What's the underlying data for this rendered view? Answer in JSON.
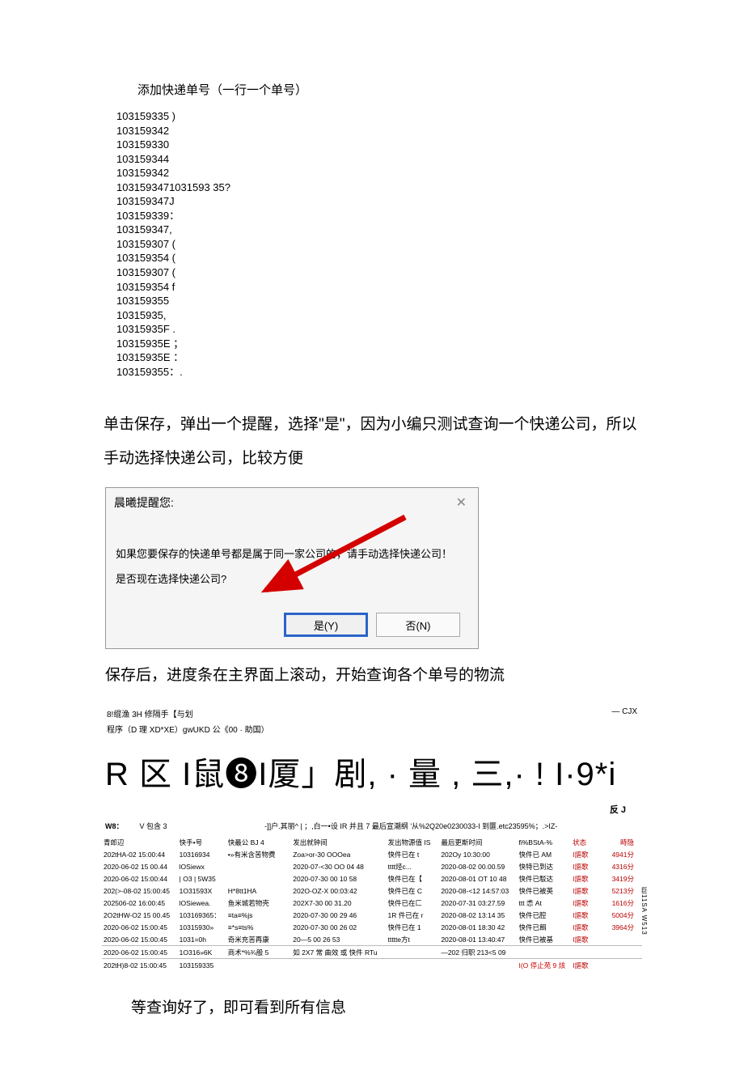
{
  "section_title": "添加快递单号（一行一个单号）",
  "numbers": [
    "103159335      )",
    "103159342",
    "103159330",
    "103159344",
    "103159342",
    "1031593471031593 35?",
    "103159347J",
    "103159339：",
    "103159347,",
    "103159307 (",
    "103159354 (",
    "103159307 (",
    "103159354 f",
    "103159355",
    "10315935,",
    "10315935F    .",
    "10315935E    ；",
    "10315935E    ：",
    "103159355：."
  ],
  "paragraph1": "单击保存，弹出一个提醒，选择\"是\"，因为小编只测试查询一个快递公司，所以手动选择快递公司，比较方便",
  "dialog": {
    "title": "晨曦提醒您:",
    "line1": "如果您要保存的快递单号都是属于同一家公司的，请手动选择快递公司！",
    "line2": "是否现在选择快递公司?",
    "yes": "是(Y)",
    "no": "否(N)"
  },
  "paragraph2": "保存后，进度条在主界面上滚动，开始查询各个单号的物流",
  "app": {
    "header_left": "8!绲渔 3H 修隔手【与划",
    "header_right": "— CJX",
    "sub": "程序（D 理 XD*XE）gwUKD 公《00 · 助国）"
  },
  "big_row": "R 区 I鼠❽I厦」剧, · 量 , 三,· ! I·9*i",
  "fj": "反 J",
  "table_top": {
    "w8": "W8：",
    "v": "V 包含 3",
    "filter": "-]]户.其丽^ |  ；,白一•设 IR 并且 7 最后宣潮纲 '从%2Q20e0230033-I 到匴.etc23595%；.>IZ-"
  },
  "columns": [
    "青郎辺",
    "快手•号",
    "快最公 BJ 4",
    "发出就钟间",
    "发出物源值 IS",
    "最后更斯时间",
    "fi%BStA-%",
    "状态",
    "時隐"
  ],
  "rows": [
    [
      "202tHA-02 15:00:44",
      "10316934",
      "•»有米含苦物费",
      "Zoa>or-30 OOOea",
      "快件已在 t",
      "202Oy 10:30:00",
      "快件已 AM",
      "I謳歌",
      "4941分"
    ],
    [
      "2020-06-02 15 00.44",
      "lOSiewx",
      "",
      "2020-07-<30 OO 04 48",
      "tttt烃c...",
      "2020-08-02 00.00.59",
      "快特已到达",
      "I謳歌",
      "4316分"
    ],
    [
      "2020-06-02 15:00:44",
      "| O3 | 5W35",
      "",
      "2020-07-30 00 10 58",
      "快件已在【",
      "2020-08-01 OT 10 48",
      "快件已駁达",
      "I謳歌",
      "3419分"
    ],
    [
      "202(>-08-02 15:00:45",
      "1O31593X",
      "H*8tt1HA",
      "202O-OZ-X 00:03:42",
      "快件已在 C",
      "2020-08-<12 14:57:03",
      "快件已被英",
      "I謳歌",
      "5213分"
    ],
    [
      "202506-02 16:00:45",
      "lOSiewea.",
      "鱼米城若物壳",
      "202X7-30 00 31.20",
      "快件已在匚",
      "2020-07-31 03:27.59",
      "ttt 怸 At",
      "I謳歌",
      "1616分"
    ],
    [
      "2O2tHW-O2 15 00.45",
      "103169365：",
      "≡ta≡%js",
      "2020-07-30 00 29 46",
      "1R 件已在 r",
      "2020-08-02 13:14 35",
      "快件已腔",
      "I謳歌",
      "5004分"
    ],
    [
      "2020-06-02 15:00:45",
      "10315930»",
      "≡*s≡ts%",
      "2020-07-30 00 26 02",
      "快件已在 1",
      "2020-08-01 18:30 42",
      "快件已餌",
      "I謳歌",
      "3964分"
    ],
    [
      "2020-06-02 15:00:45",
      "1031=0h",
      "奇米充苦再康",
      "20—5 00 26 53",
      "ttttte方t",
      "2020-08-01 13:40:47",
      "快件已被基",
      "I謳歌",
      ""
    ],
    [
      "2020-06-02 15:00:45",
      "1O316»6K",
      "商术*%¾般 5",
      "如 2X7 常 曲效 或 快件 RTu",
      "",
      "—202 归职 213<5 09",
      "",
      "",
      ""
    ],
    [
      "202tH)8-02 15:00:45",
      "103159335",
      "",
      "",
      "",
      "",
      "I(O 停止苑 9 烗",
      "I謳歌",
      ""
    ]
  ],
  "side_txt": "巨11SA\nW513",
  "paragraph3": "等查询好了，即可看到所有信息"
}
